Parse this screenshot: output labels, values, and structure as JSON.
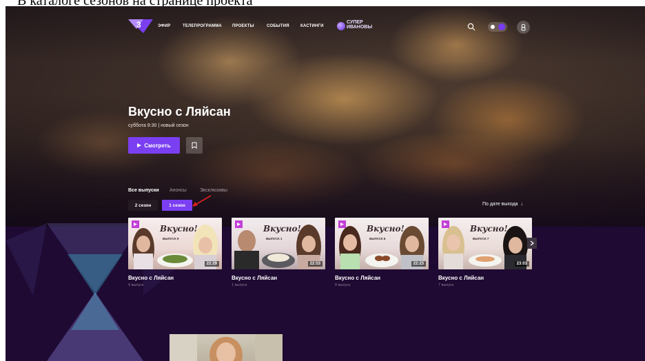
{
  "caption": "В каталоге сезонов на странице проекта",
  "nav": {
    "items": [
      "ЭФИР",
      "ТЕЛЕПРОГРАММА",
      "ПРОЕКТЫ",
      "СОБЫТИЯ",
      "КАСТИНГИ"
    ],
    "super_label": "СУПЕР ИВАНОВЫ"
  },
  "show": {
    "title": "Вкусно с Ляйсан",
    "subtitle": "суббота 9:30 | новый сезон",
    "watch_label": "Смотреть"
  },
  "tabs": [
    "Все выпуски",
    "Анонсы",
    "Эксклюзивы"
  ],
  "seasons": [
    "2 сезон",
    "1 сезон"
  ],
  "sort_label": "По дате выхода",
  "cards": [
    {
      "title": "Вкусно с Ляйсан",
      "subtitle": "9 выпуск",
      "duration": "22:29",
      "badge": "ВЫПУСК 9"
    },
    {
      "title": "Вкусно с Ляйсан",
      "subtitle": "1 выпуск",
      "duration": "22:53",
      "badge": "ВЫПУСК 1"
    },
    {
      "title": "Вкусно с Ляйсан",
      "subtitle": "8 выпуск",
      "duration": "22:23",
      "badge": "ВЫПУСК 8"
    },
    {
      "title": "Вкусно с Ляйсан",
      "subtitle": "7 выпуск",
      "duration": "23:03",
      "badge": "ВЫПУСК 7"
    }
  ],
  "colors": {
    "accent": "#7b3ff2",
    "background": "#1f0a33",
    "annotation": "#e02020"
  }
}
